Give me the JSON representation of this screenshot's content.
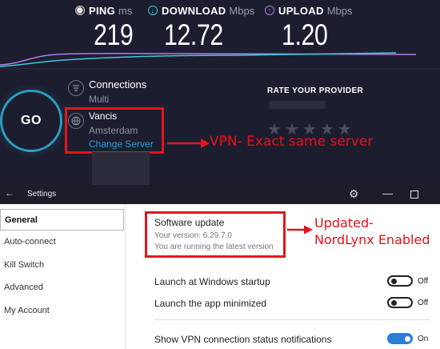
{
  "speedtest": {
    "metrics": [
      {
        "icon": "ping-icon",
        "label": "PING",
        "unit": "ms",
        "value": "219"
      },
      {
        "icon": "download-icon",
        "label": "DOWNLOAD",
        "unit": "Mbps",
        "value": "12.72"
      },
      {
        "icon": "upload-icon",
        "label": "UPLOAD",
        "unit": "Mbps",
        "value": "1.20"
      }
    ],
    "go_label": "GO",
    "connections_title": "Connections",
    "connections_value": "Multi",
    "server_name": "Vancis",
    "server_location": "Amsterdam",
    "change_server_label": "Change Server",
    "rate_title": "RATE YOUR PROVIDER",
    "stars": [
      "★",
      "★",
      "★",
      "★",
      "★"
    ],
    "colors": {
      "ping": "#cfd0d8",
      "download": "#3fc8d8",
      "upload": "#b07ce6"
    }
  },
  "annotations": {
    "vpn_note": "VPN- Exact same server",
    "update_note_line1": "Updated-",
    "update_note_line2": "NordLynx Enabled",
    "color": "#e4151d"
  },
  "settings": {
    "window_title": "Settings",
    "sidebar": [
      "General",
      "Auto-connect",
      "Kill Switch",
      "Advanced",
      "My Account"
    ],
    "software_update_title": "Software update",
    "version_text": "Your version: 6.29.7.0",
    "latest_text": "You are running the latest version",
    "rows": [
      {
        "label": "Launch at Windows startup",
        "state": "Off"
      },
      {
        "label": "Launch the app minimized",
        "state": "Off"
      },
      {
        "label": "Show VPN connection status notifications",
        "state": "On"
      }
    ]
  }
}
